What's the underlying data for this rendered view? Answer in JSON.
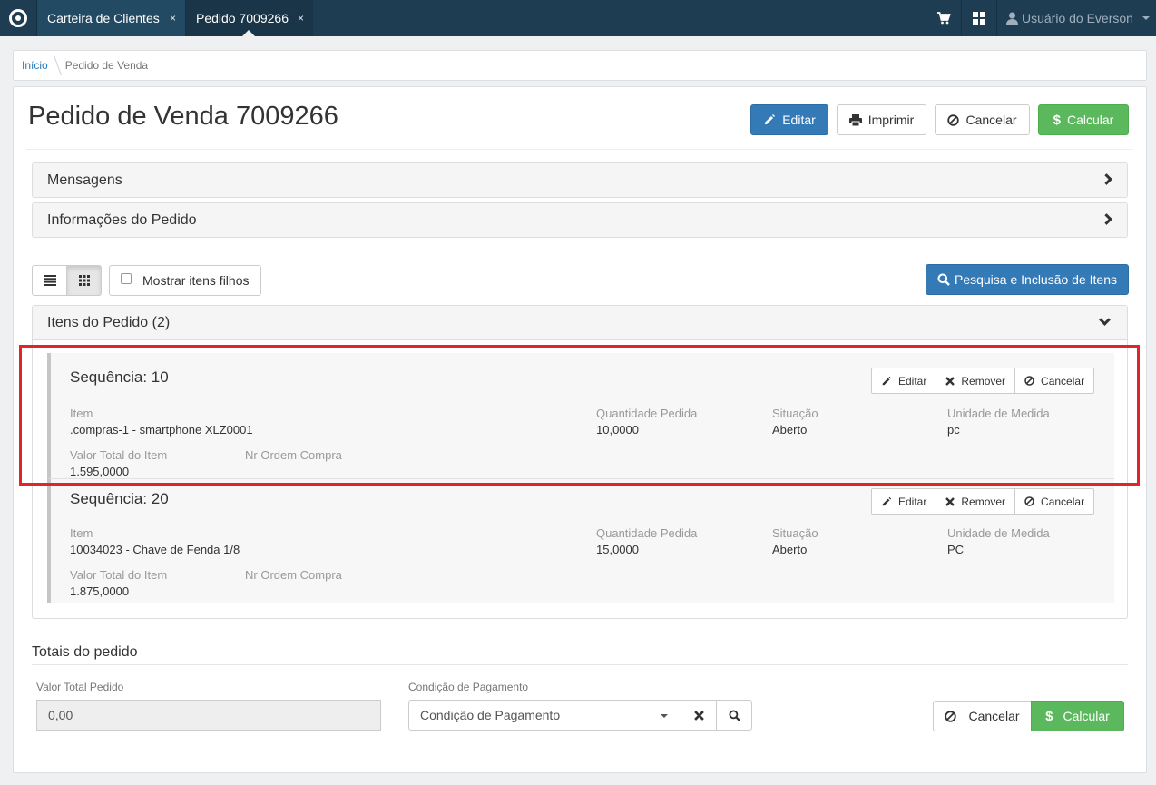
{
  "topbar": {
    "tabs": [
      {
        "label": "Carteira de Clientes",
        "close": "×"
      },
      {
        "label": "Pedido 7009266",
        "close": "×"
      }
    ],
    "user_label": "Usuário do Everson",
    "icons": [
      "logo-icon",
      "cart-icon",
      "grid-apps-icon",
      "user-icon"
    ]
  },
  "breadcrumb": {
    "home": "Início",
    "current": "Pedido de Venda"
  },
  "page": {
    "title": "Pedido de Venda 7009266",
    "buttons": {
      "edit": "Editar",
      "print": "Imprimir",
      "cancel": "Cancelar",
      "calc": "Calcular"
    }
  },
  "sections": {
    "messages": "Mensagens",
    "info": "Informações do Pedido"
  },
  "toolbar": {
    "show_children": "Mostrar itens filhos",
    "search_add": "Pesquisa e Inclusão de Itens"
  },
  "items": {
    "header": "Itens do Pedido (2)",
    "labels": {
      "item": "Item",
      "qty": "Quantidade Pedida",
      "status": "Situação",
      "unit": "Unidade de Medida",
      "total": "Valor Total do Item",
      "po": "Nr Ordem Compra"
    },
    "actions": {
      "edit": "Editar",
      "remove": "Remover",
      "cancel": "Cancelar"
    },
    "rows": [
      {
        "seq": "Sequência: 10",
        "item": ".compras-1 - smartphone XLZ0001",
        "qty": "10,0000",
        "status": "Aberto",
        "unit": "pc",
        "total": "1.595,0000",
        "po": ""
      },
      {
        "seq": "Sequência: 20",
        "item": "10034023 - Chave de Fenda 1/8",
        "qty": "15,0000",
        "status": "Aberto",
        "unit": "PC",
        "total": "1.875,0000",
        "po": ""
      }
    ]
  },
  "totals": {
    "title": "Totais do pedido",
    "total_label": "Valor Total Pedido",
    "total_value": "0,00",
    "payment_label": "Condição de Pagamento",
    "payment_placeholder": "Condição de Pagamento",
    "cancel": "Cancelar",
    "calc": "Calcular"
  },
  "colors": {
    "topbar": "#1f3d52",
    "primary": "#337ab7",
    "success": "#5cb85c",
    "highlight": "#e0242b"
  }
}
